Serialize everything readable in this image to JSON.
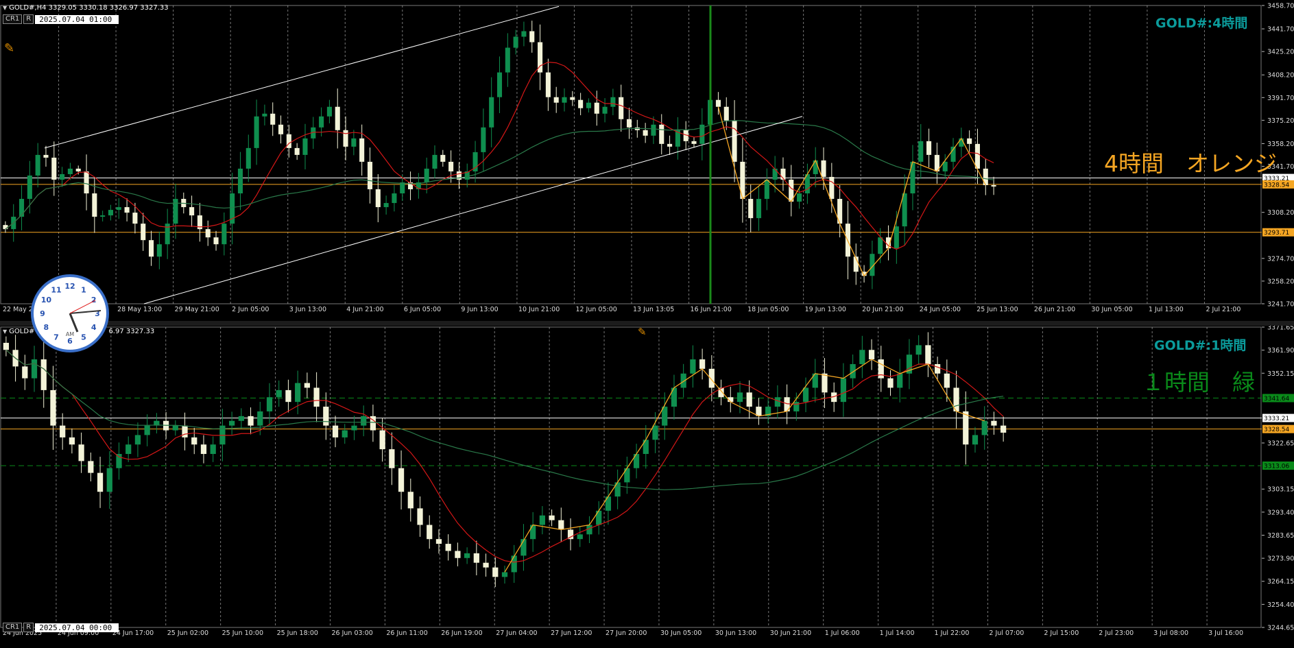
{
  "pane1": {
    "header": "GOLD#,H4 3329.05 3330.18 3326.97 3327.33",
    "stamp_box1": "CR1",
    "stamp_box2": "R",
    "stamp_time": "2025.07.04 01:00",
    "title": "GOLD#:4時間",
    "note": "4時間　オレンジ",
    "note_color": "#f5a623"
  },
  "pane2": {
    "header_left": "GOLD#",
    "header_right": "6.97 3327.33",
    "stamp_box1": "CR1",
    "stamp_box2": "R",
    "stamp_time": "2025.07.04 00:00",
    "title": "GOLD#:1時間",
    "note": "１時間　緑",
    "note_color": "#0a8a1a"
  },
  "chart_data": [
    {
      "type": "candlestick",
      "symbol": "GOLD#",
      "timeframe": "H4",
      "title": "GOLD#:4時間",
      "y_ticks": [
        "3458.70",
        "3441.70",
        "3425.20",
        "3408.20",
        "3391.70",
        "3375.20",
        "3358.20",
        "3341.70",
        "3308.20",
        "3274.70",
        "3258.20",
        "3241.70"
      ],
      "ylim": [
        3241.7,
        3458.7
      ],
      "x_ticks": [
        "22 May 20",
        "27 May 05:00",
        "28 May 13:00",
        "29 May 21:00",
        "2 Jun 05:00",
        "3 Jun 13:00",
        "4 Jun 21:00",
        "6 Jun 05:00",
        "9 Jun 13:00",
        "10 Jun 21:00",
        "12 Jun 05:00",
        "13 Jun 13:05",
        "16 Jun 21:00",
        "18 Jun 05:00",
        "19 Jun 13:00",
        "20 Jun 21:00",
        "24 Jun 05:00",
        "25 Jun 13:00",
        "26 Jun 21:00",
        "30 Jun 05:00",
        "1 Jul 13:00",
        "2 Jul 21:00"
      ],
      "price_labels": [
        {
          "value": "3333.21",
          "color": "#ffffff"
        },
        {
          "value": "3328.54",
          "color": "#f5a623"
        },
        {
          "value": "3293.71",
          "color": "#f5a623"
        }
      ],
      "closes": [
        3296,
        3305,
        3318,
        3335,
        3350,
        3348,
        3332,
        3336,
        3340,
        3338,
        3322,
        3305,
        3306,
        3310,
        3312,
        3308,
        3300,
        3288,
        3276,
        3285,
        3300,
        3318,
        3312,
        3306,
        3296,
        3290,
        3285,
        3300,
        3322,
        3340,
        3355,
        3378,
        3380,
        3372,
        3365,
        3355,
        3350,
        3362,
        3370,
        3378,
        3385,
        3368,
        3356,
        3362,
        3345,
        3325,
        3312,
        3315,
        3322,
        3330,
        3325,
        3330,
        3340,
        3350,
        3345,
        3338,
        3332,
        3338,
        3352,
        3370,
        3392,
        3410,
        3428,
        3436,
        3440,
        3432,
        3410,
        3392,
        3388,
        3392,
        3390,
        3384,
        3388,
        3380,
        3385,
        3392,
        3376,
        3370,
        3368,
        3364,
        3372,
        3358,
        3356,
        3368,
        3360,
        3358,
        3372,
        3390,
        3385,
        3375,
        3345,
        3318,
        3304,
        3318,
        3332,
        3340,
        3332,
        3316,
        3322,
        3336,
        3346,
        3334,
        3318,
        3300,
        3276,
        3265,
        3262,
        3278,
        3290,
        3282,
        3298,
        3322,
        3345,
        3360,
        3350,
        3338,
        3345,
        3356,
        3362,
        3358,
        3340,
        3328,
        3327
      ]
    },
    {
      "type": "candlestick",
      "symbol": "GOLD#",
      "timeframe": "H1",
      "title": "GOLD#:1時間",
      "y_ticks": [
        "3371.65",
        "3361.90",
        "3352.15",
        "3322.65",
        "3303.15",
        "3293.40",
        "3283.65",
        "3273.90",
        "3264.15",
        "3254.40",
        "3244.65"
      ],
      "ylim": [
        3244.65,
        3371.65
      ],
      "x_ticks": [
        "24 Jun 2025",
        "24 Jun 09:00",
        "24 Jun 17:00",
        "25 Jun 02:00",
        "25 Jun 10:00",
        "25 Jun 18:00",
        "26 Jun 03:00",
        "26 Jun 11:00",
        "26 Jun 19:00",
        "27 Jun 04:00",
        "27 Jun 12:00",
        "27 Jun 20:00",
        "30 Jun 05:00",
        "30 Jun 13:00",
        "30 Jun 21:00",
        "1 Jul 06:00",
        "1 Jul 14:00",
        "1 Jul 22:00",
        "2 Jul 07:00",
        "2 Jul 15:00",
        "2 Jul 23:00",
        "3 Jul 08:00",
        "3 Jul 16:00"
      ],
      "price_labels": [
        {
          "value": "3341.64",
          "color": "#0a8a1a"
        },
        {
          "value": "3333.21",
          "color": "#ffffff"
        },
        {
          "value": "3328.54",
          "color": "#f5a623"
        },
        {
          "value": "3313.06",
          "color": "#0a8a1a"
        }
      ],
      "closes": [
        3362,
        3355,
        3350,
        3358,
        3345,
        3330,
        3325,
        3322,
        3315,
        3310,
        3302,
        3312,
        3318,
        3322,
        3326,
        3330,
        3332,
        3328,
        3330,
        3325,
        3322,
        3318,
        3322,
        3330,
        3332,
        3334,
        3330,
        3336,
        3342,
        3345,
        3340,
        3348,
        3346,
        3338,
        3330,
        3325,
        3328,
        3330,
        3334,
        3328,
        3320,
        3312,
        3302,
        3295,
        3288,
        3282,
        3280,
        3277,
        3274,
        3276,
        3272,
        3270,
        3266,
        3268,
        3275,
        3282,
        3288,
        3292,
        3290,
        3286,
        3282,
        3284,
        3288,
        3294,
        3300,
        3306,
        3312,
        3318,
        3324,
        3330,
        3338,
        3346,
        3352,
        3358,
        3354,
        3346,
        3342,
        3340,
        3344,
        3338,
        3334,
        3338,
        3342,
        3336,
        3340,
        3346,
        3352,
        3344,
        3340,
        3350,
        3356,
        3362,
        3358,
        3350,
        3346,
        3352,
        3360,
        3364,
        3356,
        3352,
        3346,
        3336,
        3322,
        3326,
        3332,
        3330,
        3327
      ]
    }
  ],
  "clock": {
    "label": "AM",
    "numbers": [
      "12",
      "1",
      "2",
      "3",
      "4",
      "5",
      "6",
      "7",
      "8",
      "9",
      "10",
      "11"
    ]
  }
}
